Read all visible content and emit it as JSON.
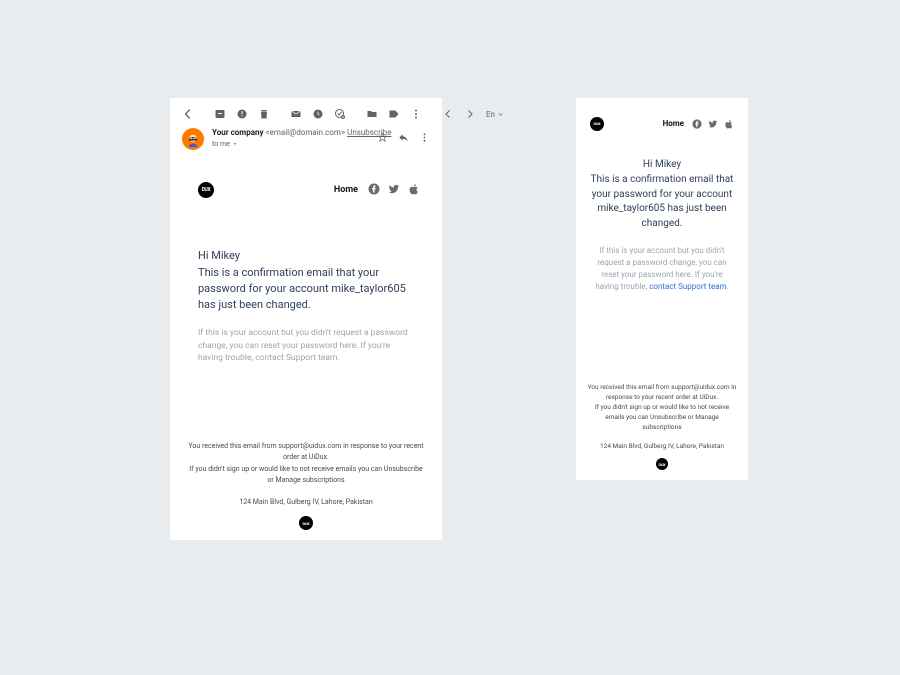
{
  "toolbar": {
    "lang": "En"
  },
  "sender": {
    "company": "Your company",
    "email": "<email@domain.com>",
    "unsubscribe": "Unsubscribe",
    "to": "to me"
  },
  "email": {
    "home": "Home",
    "logo_text": "DUX",
    "greeting": "Hi Mikey",
    "main": "This is a confirmation email that your password for your account mike_taylor605 has just been changed.",
    "sub_desktop": "If this is your account but you didn't request a password change, you can reset your password here. If you're having trouble, contact Support team.",
    "sub_mobile_pre": "If this is your account but you didn't request a password change, you can reset your password here. If you're having trouble, ",
    "sub_mobile_link": "contact Support team",
    "sub_mobile_post": "."
  },
  "footer": {
    "line1": "You received this email from support@uidux.com in response to your recent order at UiDux.",
    "line2": "If you didn't sign up or would like to not receive emails you can Unsubscribe or Manage subscriptions",
    "address": "124 Main Blvd, Gulberg IV, Lahore, Pakistan"
  }
}
